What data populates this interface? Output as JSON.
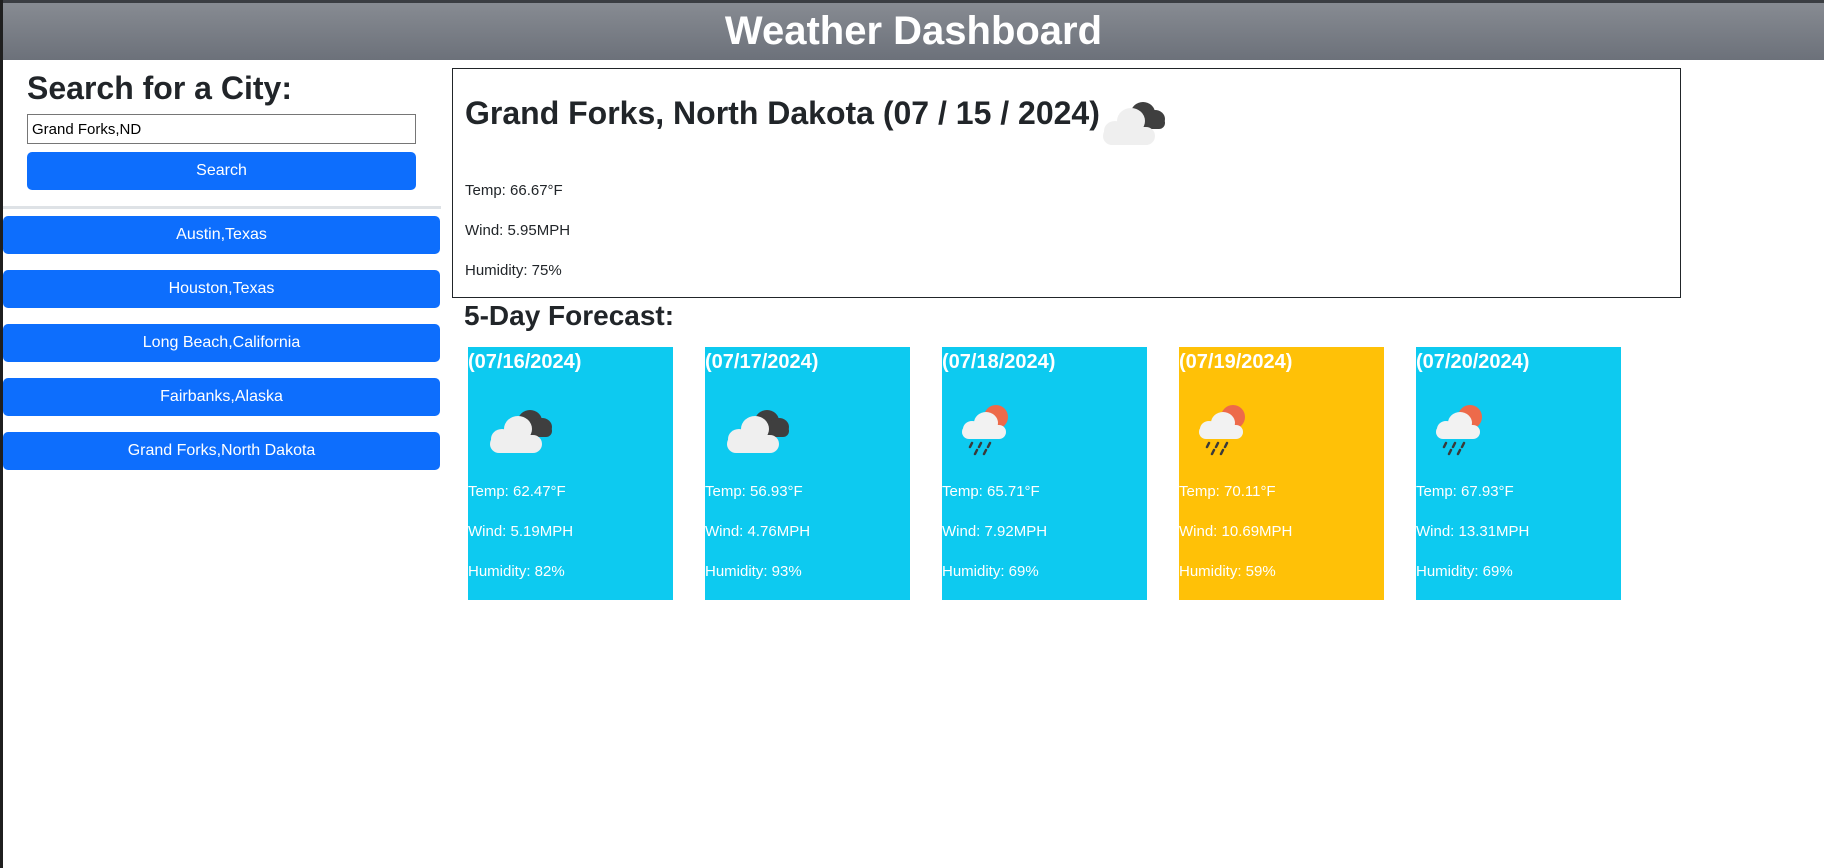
{
  "header": {
    "title": "Weather Dashboard"
  },
  "search": {
    "title": "Search for a City:",
    "input_value": "Grand Forks,ND",
    "button_label": "Search"
  },
  "history": [
    {
      "label": "Austin,Texas"
    },
    {
      "label": "Houston,Texas"
    },
    {
      "label": "Long Beach,California"
    },
    {
      "label": "Fairbanks,Alaska"
    },
    {
      "label": "Grand Forks,North Dakota"
    }
  ],
  "current": {
    "title": "Grand Forks, North Dakota (07 / 15 / 2024)",
    "icon": "cloudy-icon",
    "temp": "Temp: 66.67°F",
    "wind": "Wind: 5.95MPH",
    "humidity": "Humidity: 75%"
  },
  "forecast": {
    "title": "5-Day Forecast:",
    "days": [
      {
        "date": "(07/16/2024)",
        "icon": "cloudy-icon",
        "temp": "Temp: 62.47°F",
        "wind": "Wind: 5.19MPH",
        "humidity": "Humidity: 82%",
        "color": "#0dcaf0"
      },
      {
        "date": "(07/17/2024)",
        "icon": "cloudy-icon",
        "temp": "Temp: 56.93°F",
        "wind": "Wind: 4.76MPH",
        "humidity": "Humidity: 93%",
        "color": "#0dcaf0"
      },
      {
        "date": "(07/18/2024)",
        "icon": "rain-sun-icon",
        "temp": "Temp: 65.71°F",
        "wind": "Wind: 7.92MPH",
        "humidity": "Humidity: 69%",
        "color": "#0dcaf0"
      },
      {
        "date": "(07/19/2024)",
        "icon": "rain-sun-icon",
        "temp": "Temp: 70.11°F",
        "wind": "Wind: 10.69MPH",
        "humidity": "Humidity: 59%",
        "color": "#ffc107"
      },
      {
        "date": "(07/20/2024)",
        "icon": "rain-sun-icon",
        "temp": "Temp: 67.93°F",
        "wind": "Wind: 13.31MPH",
        "humidity": "Humidity: 69%",
        "color": "#0dcaf0"
      }
    ]
  },
  "colors": {
    "primary_button": "#0d6efd",
    "forecast_cool": "#0dcaf0",
    "forecast_warm": "#ffc107",
    "header_gray": "#6c757d"
  }
}
